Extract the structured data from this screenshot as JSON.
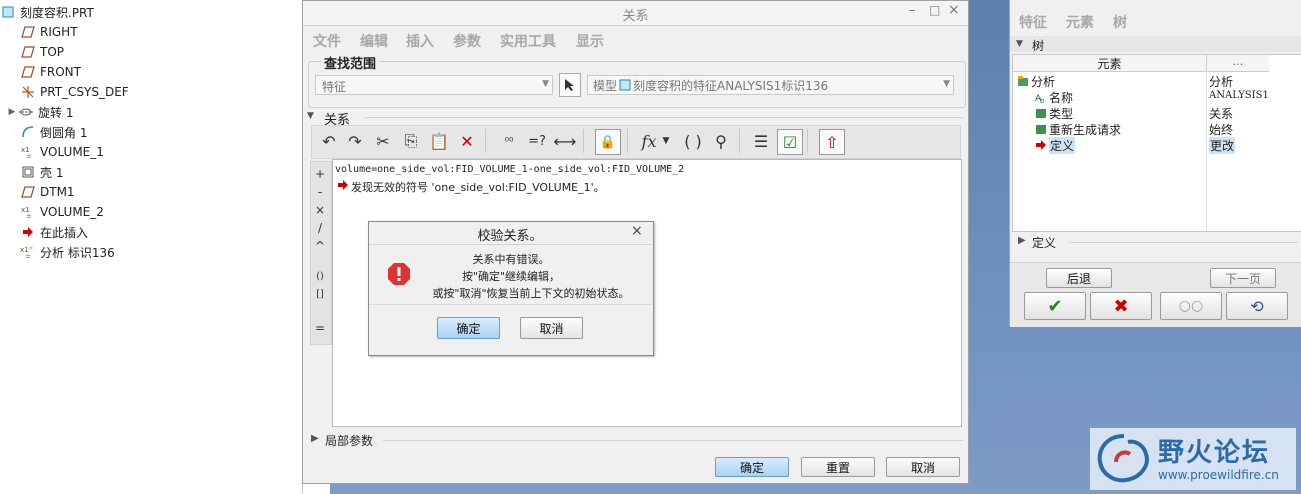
{
  "model_tree": {
    "items": [
      {
        "label": "刻度容积.PRT",
        "icon": "part-icon",
        "expand": false
      },
      {
        "label": "RIGHT",
        "icon": "datum-plane-icon",
        "expand": false
      },
      {
        "label": "TOP",
        "icon": "datum-plane-icon",
        "expand": false
      },
      {
        "label": "FRONT",
        "icon": "datum-plane-icon",
        "expand": false
      },
      {
        "label": "PRT_CSYS_DEF",
        "icon": "csys-icon",
        "expand": false
      },
      {
        "label": "旋转 1",
        "icon": "revolve-icon",
        "expand": true
      },
      {
        "label": "倒圆角 1",
        "icon": "round-icon",
        "expand": false
      },
      {
        "label": "VOLUME_1",
        "icon": "analysis-icon",
        "expand": false
      },
      {
        "label": "壳 1",
        "icon": "shell-icon",
        "expand": false
      },
      {
        "label": "DTM1",
        "icon": "datum-plane-icon",
        "expand": false
      },
      {
        "label": "VOLUME_2",
        "icon": "analysis-icon",
        "expand": false
      },
      {
        "label": "在此插入",
        "icon": "insert-here-icon",
        "expand": false
      },
      {
        "label": "分析 标识136",
        "icon": "analysis-new-icon",
        "expand": false
      }
    ]
  },
  "relations": {
    "title": "关系",
    "menu": [
      "文件",
      "编辑",
      "插入",
      "参数",
      "实用工具",
      "显示"
    ],
    "scope_label": "查找范围",
    "scope_type": "特征",
    "scope_target": "模型",
    "scope_target_value": "刻度容积的特征ANALYSIS1标识136",
    "section_relations": "关系",
    "editor_line1": "volume=one_side_vol:FID_VOLUME_1-one_side_vol:FID_VOLUME_2",
    "editor_line2": "发现无效的符号 'one_side_vol:FID_VOLUME_1'。",
    "ops": [
      "+",
      "-",
      "×",
      "/",
      "^",
      "()",
      "[]",
      "="
    ],
    "local_params": "局部参数",
    "ok": "确定",
    "reset": "重置",
    "cancel": "取消"
  },
  "verify": {
    "title": "校验关系。",
    "line1": "关系中有错误。",
    "line2": "按\"确定\"继续编辑，",
    "line3": "或按\"取消\"恢复当前上下文的初始状态。",
    "ok": "确定",
    "cancel": "取消"
  },
  "element_panel": {
    "menu": [
      "特征",
      "元素",
      "树"
    ],
    "tree_label": "树",
    "col_element": "元素",
    "col_info": "...",
    "rows": [
      {
        "name": "分析",
        "value": "分析"
      },
      {
        "name": "名称",
        "value": "ANALYSIS1"
      },
      {
        "name": "类型",
        "value": "关系"
      },
      {
        "name": "重新生成请求",
        "value": "始终"
      },
      {
        "name": "定义",
        "value": "更改"
      }
    ],
    "define_label": "定义",
    "back": "后退",
    "next": "下一页"
  },
  "watermark": {
    "title": "野火论坛",
    "url": "www.proewildfire.cn"
  },
  "colors": {
    "accent_blue": "#3f6fb0",
    "error_red": "#d33",
    "desktop": "#6f91c1"
  }
}
